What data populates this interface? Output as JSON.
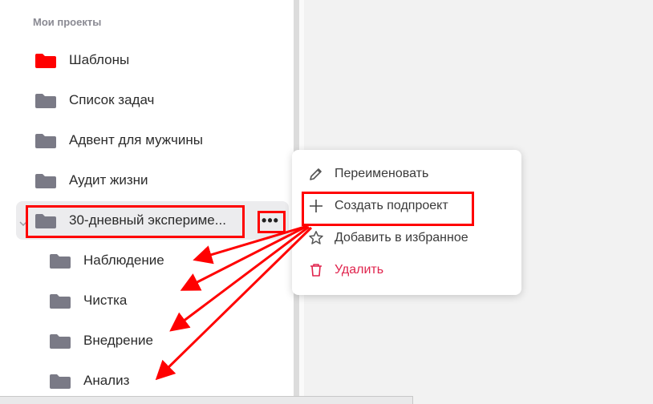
{
  "sidebar": {
    "section_title": "Мои проекты",
    "projects": [
      {
        "label": "Шаблоны",
        "folder_color": "#ff0000"
      },
      {
        "label": "Список задач",
        "folder_color": "#7a7a86"
      },
      {
        "label": "Адвент для мужчины",
        "folder_color": "#7a7a86"
      },
      {
        "label": "Аудит жизни",
        "folder_color": "#7a7a86"
      },
      {
        "label": "30-дневный экспериме...",
        "folder_color": "#7a7a86",
        "expanded": true
      },
      {
        "label": "Наблюдение",
        "folder_color": "#7a7a86"
      },
      {
        "label": "Чистка",
        "folder_color": "#7a7a86"
      },
      {
        "label": "Внедрение",
        "folder_color": "#7a7a86"
      },
      {
        "label": "Анализ",
        "folder_color": "#7a7a86"
      }
    ],
    "more_label": "•••"
  },
  "context_menu": {
    "items": [
      {
        "label": "Переименовать",
        "icon": "pencil-icon"
      },
      {
        "label": "Создать подпроект",
        "icon": "plus-icon"
      },
      {
        "label": "Добавить в избранное",
        "icon": "star-icon"
      },
      {
        "label": "Удалить",
        "icon": "trash-icon",
        "danger": true
      }
    ]
  },
  "annotations": {
    "highlight_color": "#ff0000"
  },
  "status_url": ""
}
